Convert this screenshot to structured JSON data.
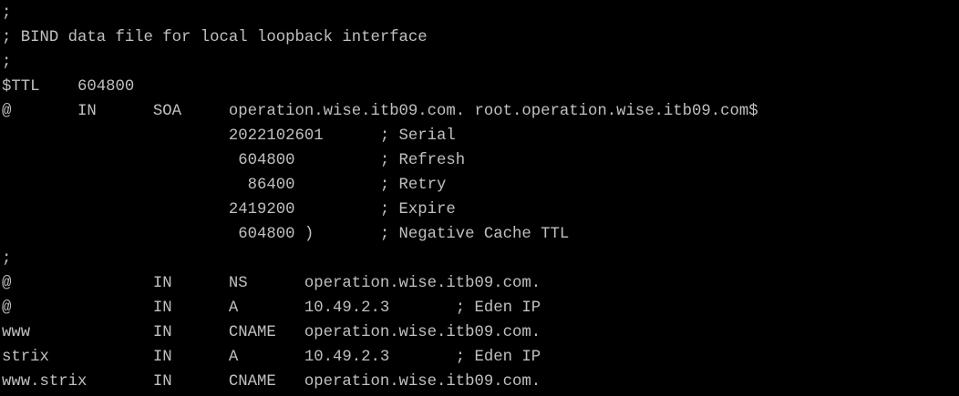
{
  "terminal": {
    "background": "#000000",
    "foreground": "#c0c0c0",
    "lines": [
      ";",
      "; BIND data file for local loopback interface",
      ";",
      "$TTL    604800",
      "@       IN      SOA     operation.wise.itb09.com. root.operation.wise.itb09.com$",
      "                        2022102601      ; Serial",
      "                         604800         ; Refresh",
      "                          86400         ; Retry",
      "                        2419200         ; Expire",
      "                         604800 )       ; Negative Cache TTL",
      ";",
      "@               IN      NS      operation.wise.itb09.com.",
      "@               IN      A       10.49.2.3       ; Eden IP",
      "www             IN      CNAME   operation.wise.itb09.com.",
      "strix           IN      A       10.49.2.3       ; Eden IP",
      "www.strix       IN      CNAME   operation.wise.itb09.com."
    ]
  }
}
